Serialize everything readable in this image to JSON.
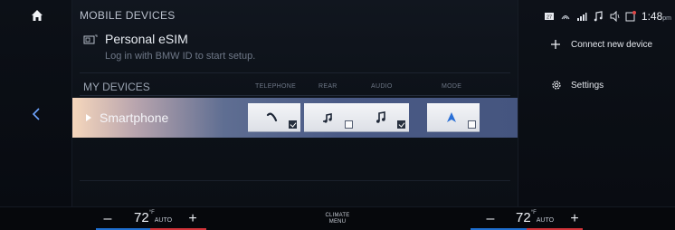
{
  "colors": {
    "accent_blue": "#1f6fd0",
    "accent_red": "#d2343a",
    "device_row_gradient": [
      "#f6d7bc",
      "#4a5a86"
    ]
  },
  "left_rail": {
    "home_icon": "home-icon",
    "back_icon": "chevron-left-icon"
  },
  "main": {
    "header": "MOBILE DEVICES",
    "esim": {
      "icon": "esim-card-icon",
      "title": "Personal eSIM",
      "subtitle": "Log in with BMW ID to start setup."
    },
    "my_devices": {
      "title": "MY DEVICES",
      "columns": [
        "TELEPHONE",
        "REAR",
        "AUDIO",
        "MODE"
      ]
    },
    "devices": [
      {
        "name": "Smartphone",
        "functions": [
          {
            "name": "telephone",
            "icon": "phone-icon",
            "checked": true
          },
          {
            "name": "rear",
            "icon": "rear-audio-icon",
            "checked": false
          },
          {
            "name": "audio",
            "icon": "music-note-icon",
            "checked": true
          },
          {
            "name": "mode",
            "icon": "navigation-arrow-icon",
            "checked": false
          }
        ]
      }
    ]
  },
  "right_panel": {
    "status": {
      "icons": [
        "messages-icon",
        "wifi-calling-icon",
        "signal-icon",
        "music-note-icon",
        "speaker-icon",
        "notification-icon"
      ],
      "time": "1:48",
      "ampm": "pm"
    },
    "menu": [
      {
        "label": "Connect new device",
        "icon": "plus-icon"
      },
      {
        "label": "Settings",
        "icon": "gear-icon"
      }
    ]
  },
  "bottom_bar": {
    "left": {
      "minus": "–",
      "temp": "72",
      "unit": "°F",
      "mode": "AUTO",
      "plus": "+"
    },
    "center": {
      "line1": "CLIMATE",
      "line2": "MENU"
    },
    "right": {
      "minus": "–",
      "temp": "72",
      "unit": "°F",
      "mode": "AUTO",
      "plus": "+"
    }
  }
}
